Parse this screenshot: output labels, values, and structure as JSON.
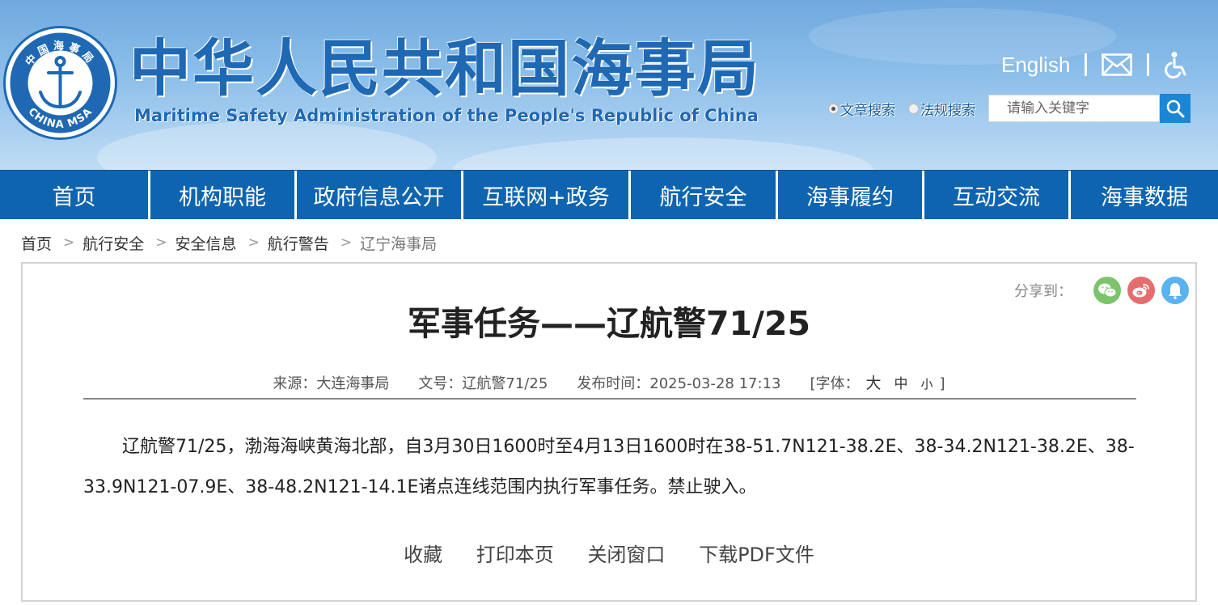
{
  "header": {
    "emblem_text_top": "中国海事局",
    "emblem_text_bottom": "CHINA MSA",
    "title_cn": "中华人民共和国海事局",
    "title_en": "Maritime Safety Administration of the People's Republic of China",
    "english_link": "English",
    "search": {
      "option_article": "文章搜索",
      "option_law": "法规搜索",
      "placeholder": "请输入关键字"
    }
  },
  "nav": {
    "items": [
      "首页",
      "机构职能",
      "政府信息公开",
      "互联网+政务",
      "航行安全",
      "海事履约",
      "互动交流",
      "海事数据"
    ]
  },
  "breadcrumb": {
    "items": [
      "首页",
      "航行安全",
      "安全信息",
      "航行警告"
    ],
    "current": "辽宁海事局",
    "separator": ">"
  },
  "article": {
    "share_label": "分享到：",
    "title": "军事任务——辽航警71/25",
    "source": "来源：大连海事局",
    "doc_no": "文号：辽航警71/25",
    "publish_time": "发布时间：2025-03-28 17:13",
    "font_label": "[字体：",
    "font_large": "大",
    "font_medium": "中",
    "font_small": "小",
    "font_close": "]",
    "body": "辽航警71/25，渤海海峡黄海北部，自3月30日1600时至4月13日1600时在38-51.7N121-38.2E、38-34.2N121-38.2E、38-33.9N121-07.9E、38-48.2N121-14.1E诸点连线范围内执行军事任务。禁止驶入。",
    "actions": {
      "favorite": "收藏",
      "print": "打印本页",
      "close": "关闭窗口",
      "pdf": "下载PDF文件"
    }
  },
  "colors": {
    "nav_bg": "#0f64b0",
    "title_blue": "#1f68b3",
    "wechat": "#7bc46a",
    "weibo": "#e56d6d",
    "qq": "#58b3f0"
  }
}
